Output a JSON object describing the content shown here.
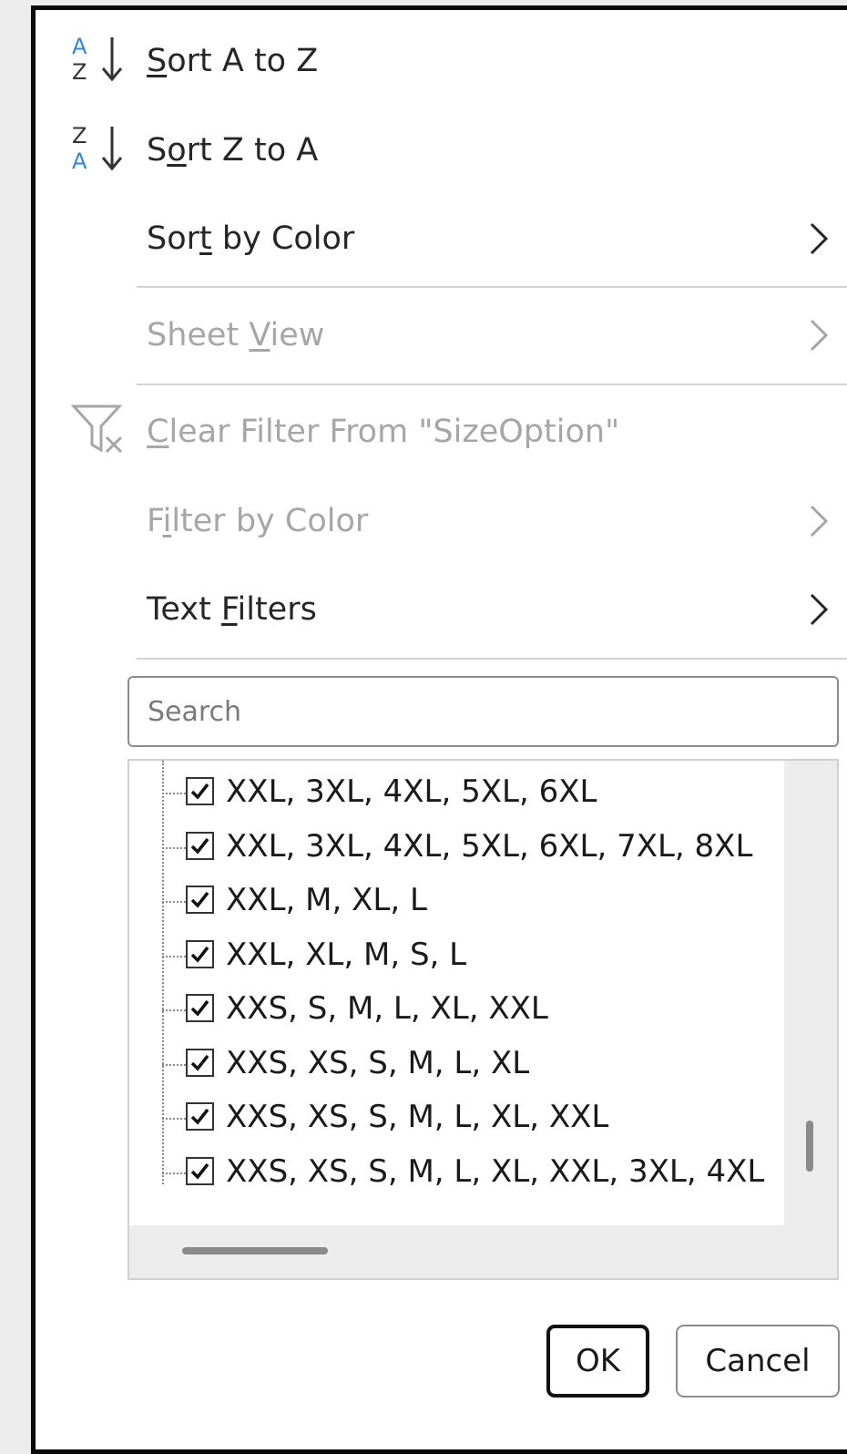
{
  "menu": {
    "sort_az": "Sort A to Z",
    "sort_za": "Sort Z to A",
    "sort_by_color": "Sort by Color",
    "sheet_view": "Sheet View",
    "clear_filter": "Clear Filter From \"SizeOption\"",
    "filter_by_color": "Filter by Color",
    "text_filters": "Text Filters"
  },
  "icons": {
    "sort_az": "sort-ascending-icon",
    "sort_za": "sort-descending-icon",
    "clear_filter": "clear-filter-icon",
    "submenu": "chevron-right-icon"
  },
  "search": {
    "placeholder": "Search"
  },
  "list": {
    "items": [
      "XXL, 3XL, 4XL, 5XL, 6XL",
      "XXL, 3XL, 4XL, 5XL, 6XL, 7XL, 8XL",
      "XXL, M, XL, L",
      "XXL, XL, M, S, L",
      "XXS, S, M, L, XL, XXL",
      "XXS, XS, S, M, L, XL",
      "XXS, XS, S, M, L, XL, XXL",
      "XXS, XS, S, M, L, XL, XXL, 3XL, 4XL"
    ],
    "checked": [
      true,
      true,
      true,
      true,
      true,
      true,
      true,
      true
    ]
  },
  "buttons": {
    "ok": "OK",
    "cancel": "Cancel"
  },
  "colors": {
    "accent_blue": "#2e86de",
    "disabled_text": "#a6a6a6"
  }
}
